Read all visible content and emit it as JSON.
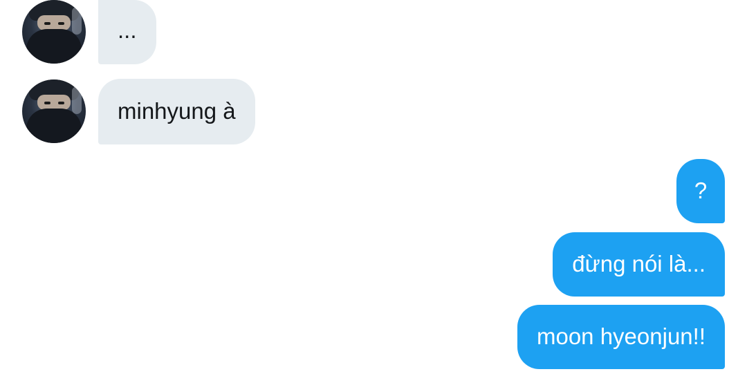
{
  "conversation": {
    "incoming_messages": [
      {
        "text": "...",
        "avatar_icon": "user-avatar-icon"
      },
      {
        "text": "minhyung à",
        "avatar_icon": "user-avatar-icon"
      }
    ],
    "outgoing_messages": [
      {
        "text": "?"
      },
      {
        "text": "đừng nói là..."
      },
      {
        "text": "moon hyeonjun!!"
      }
    ]
  },
  "colors": {
    "incoming_bubble": "#e6ecf0",
    "outgoing_bubble": "#1da1f2",
    "incoming_text": "#14171a",
    "outgoing_text": "#ffffff"
  }
}
